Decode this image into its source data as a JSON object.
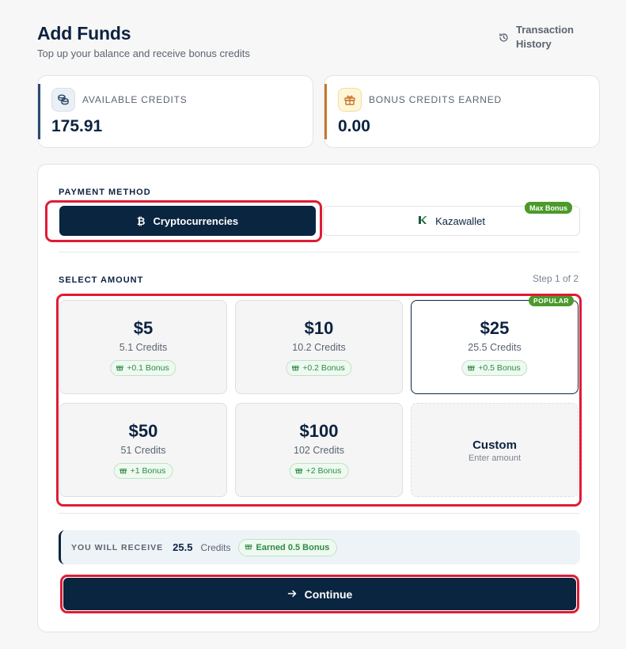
{
  "header": {
    "title": "Add Funds",
    "subtitle": "Top up your balance and receive bonus credits",
    "history_link": "Transaction History"
  },
  "stats": {
    "available": {
      "label": "AVAILABLE CREDITS",
      "value": "175.91",
      "icon": "coins-icon",
      "accent": "#2c4a6e"
    },
    "bonus": {
      "label": "BONUS CREDITS EARNED",
      "value": "0.00",
      "icon": "gift-icon",
      "accent": "#c8762a"
    }
  },
  "payment": {
    "label": "PAYMENT METHOD",
    "methods": [
      {
        "label": "Cryptocurrencies",
        "icon": "bitcoin-icon",
        "active": true
      },
      {
        "label": "Kazawallet",
        "icon": "kazawallet-logo-icon",
        "active": false,
        "badge": "Max Bonus"
      }
    ]
  },
  "amount": {
    "label": "SELECT AMOUNT",
    "step": "Step 1 of 2",
    "popular_badge": "POPULAR",
    "options": [
      {
        "price": "$5",
        "credits": "5.1 Credits",
        "bonus": "+0.1 Bonus",
        "selected": false
      },
      {
        "price": "$10",
        "credits": "10.2 Credits",
        "bonus": "+0.2 Bonus",
        "selected": false
      },
      {
        "price": "$25",
        "credits": "25.5 Credits",
        "bonus": "+0.5 Bonus",
        "selected": true
      },
      {
        "price": "$50",
        "credits": "51 Credits",
        "bonus": "+1 Bonus",
        "selected": false
      },
      {
        "price": "$100",
        "credits": "102 Credits",
        "bonus": "+2 Bonus",
        "selected": false
      }
    ],
    "custom": {
      "title": "Custom",
      "sub": "Enter amount"
    }
  },
  "summary": {
    "label": "YOU WILL RECEIVE",
    "value": "25.5",
    "unit": "Credits",
    "bonus": "Earned 0.5 Bonus"
  },
  "continue_label": "Continue",
  "colors": {
    "navy": "#0a2540",
    "highlight": "#e01b35",
    "green": "#4b9a2b"
  }
}
